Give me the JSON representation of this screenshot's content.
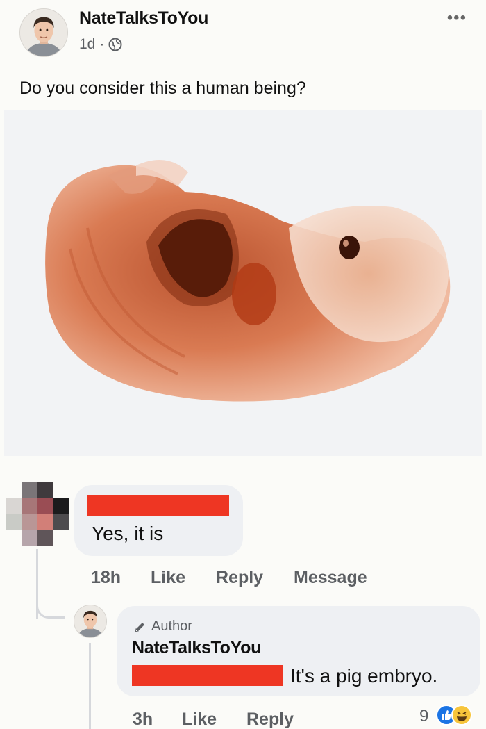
{
  "post": {
    "author": "NateTalksToYou",
    "time": "1d",
    "separator": "·",
    "text": "Do you consider this a human being?",
    "more_label": "•••"
  },
  "comments": [
    {
      "text": "Yes, it is",
      "time": "18h",
      "actions": [
        "Like",
        "Reply",
        "Message"
      ]
    }
  ],
  "reply": {
    "badge": "Author",
    "author": "NateTalksToYou",
    "text": "It's a pig embryo.",
    "time": "3h",
    "actions": [
      "Like",
      "Reply"
    ],
    "reaction_count": "9"
  },
  "colors": {
    "redaction": "#ee3623",
    "like_blue": "#1b74e4",
    "haha_yellow": "#f7c53b"
  }
}
